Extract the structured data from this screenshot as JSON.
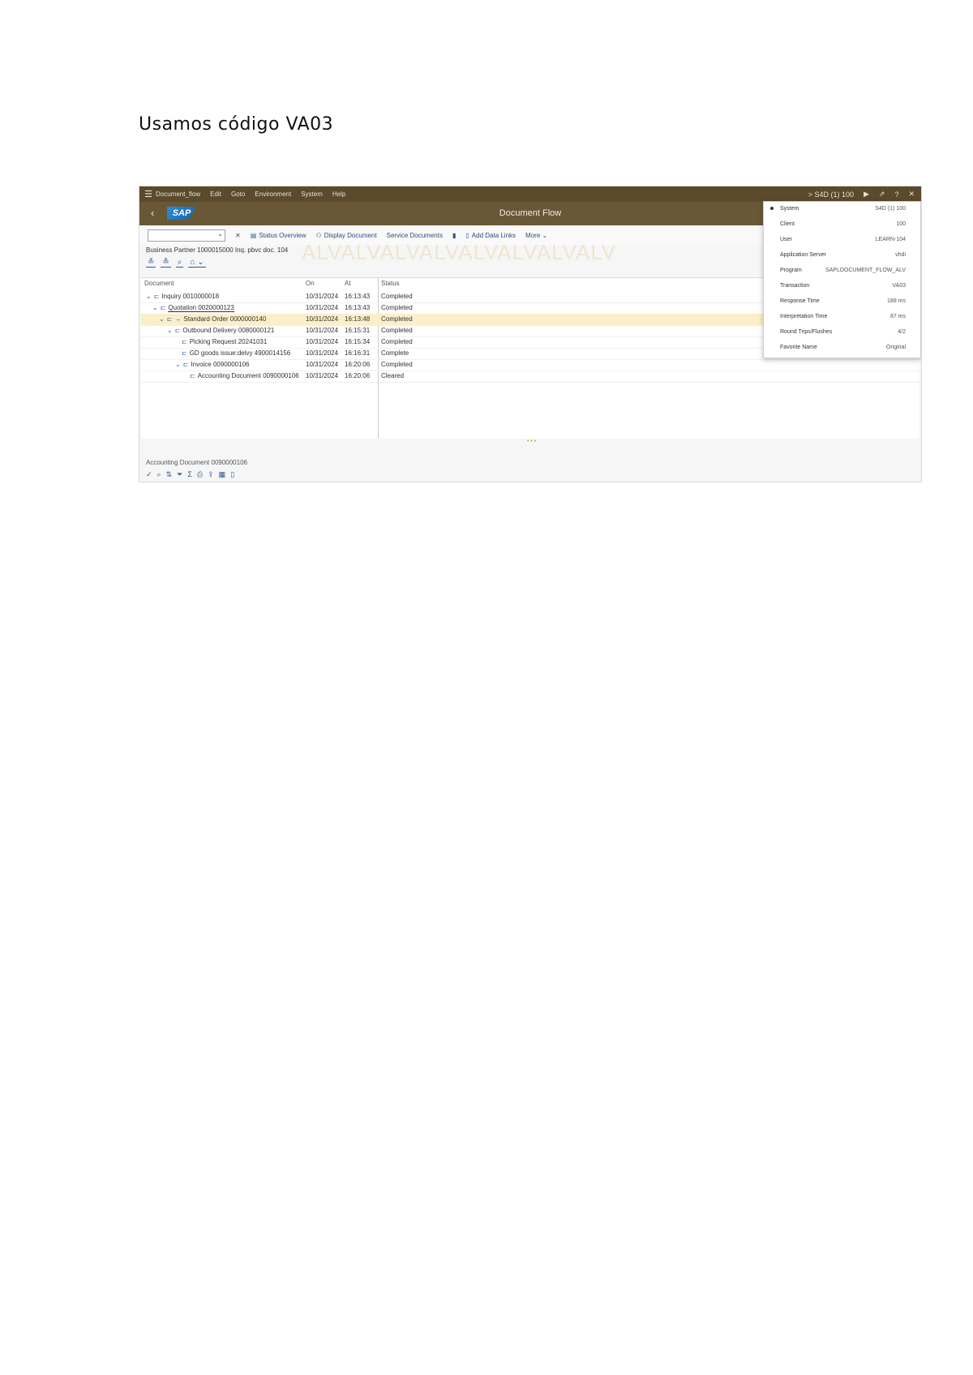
{
  "heading": "Usamos código VA03",
  "sap": {
    "menu": {
      "items": [
        "Document_flow",
        "Edit",
        "Goto",
        "Environment",
        "System",
        "Help"
      ],
      "right_system": "> S4D (1) 100",
      "icons": [
        "play-icon",
        "share-icon",
        "help-icon",
        "close-icon"
      ]
    },
    "title": {
      "back": "‹",
      "logo": "SAP",
      "text": "Document Flow"
    },
    "toolbar": {
      "items": [
        "Status Overview",
        "Display Document",
        "Service Documents",
        "Add Data Links",
        "More"
      ]
    },
    "info_line": "Business Partner 1000015000 Inq. pbvc doc. 104",
    "watermark": "ALVALVALVALVALVALVALVALV",
    "table": {
      "headers": {
        "document": "Document",
        "on": "On",
        "at": "At",
        "status": "Status"
      },
      "rows": [
        {
          "document": "Inquiry 0010000018",
          "on": "10/31/2024",
          "at": "16:13:43",
          "status": "Completed",
          "indent": 0
        },
        {
          "document": "Quotation 0020000123",
          "on": "10/31/2024",
          "at": "16:13:43",
          "status": "Completed",
          "indent": 1
        },
        {
          "document": "Standard Order 0000000140",
          "on": "10/31/2024",
          "at": "16:13:48",
          "status": "Completed",
          "indent": 2
        },
        {
          "document": "Outbound Delivery 0080000121",
          "on": "10/31/2024",
          "at": "16:15:31",
          "status": "Completed",
          "indent": 3
        },
        {
          "document": "Picking Request 20241031",
          "on": "10/31/2024",
          "at": "16:15:34",
          "status": "Completed",
          "indent": 4
        },
        {
          "document": "GD goods issue:delvy 4900014156",
          "on": "10/31/2024",
          "at": "16:16:31",
          "status": "Complete",
          "indent": 4
        },
        {
          "document": "Invoice 0090000106",
          "on": "10/31/2024",
          "at": "16:20:06",
          "status": "Completed",
          "indent": 3
        },
        {
          "document": "Accounting Document 0090000106",
          "on": "10/31/2024",
          "at": "16:20:06",
          "status": "Cleared",
          "indent": 5
        }
      ]
    },
    "bottom_line": "Accounting Document 0090000106",
    "popover": {
      "rows": [
        {
          "k": "System",
          "v": "S4D (1) 100"
        },
        {
          "k": "Client",
          "v": "100"
        },
        {
          "k": "User",
          "v": "LEARN-104"
        },
        {
          "k": "Application Server",
          "v": "vhdi"
        },
        {
          "k": "Program",
          "v": "SAPLDOCUMENT_FLOW_ALV"
        },
        {
          "k": "Transaction",
          "v": "VA03"
        },
        {
          "k": "Response Time",
          "v": "188 ms"
        },
        {
          "k": "Interpretation Time",
          "v": "87 ms"
        },
        {
          "k": "Round Trips/Flushes",
          "v": "4/2"
        },
        {
          "k": "Favorite Name",
          "v": "Original"
        }
      ]
    }
  }
}
